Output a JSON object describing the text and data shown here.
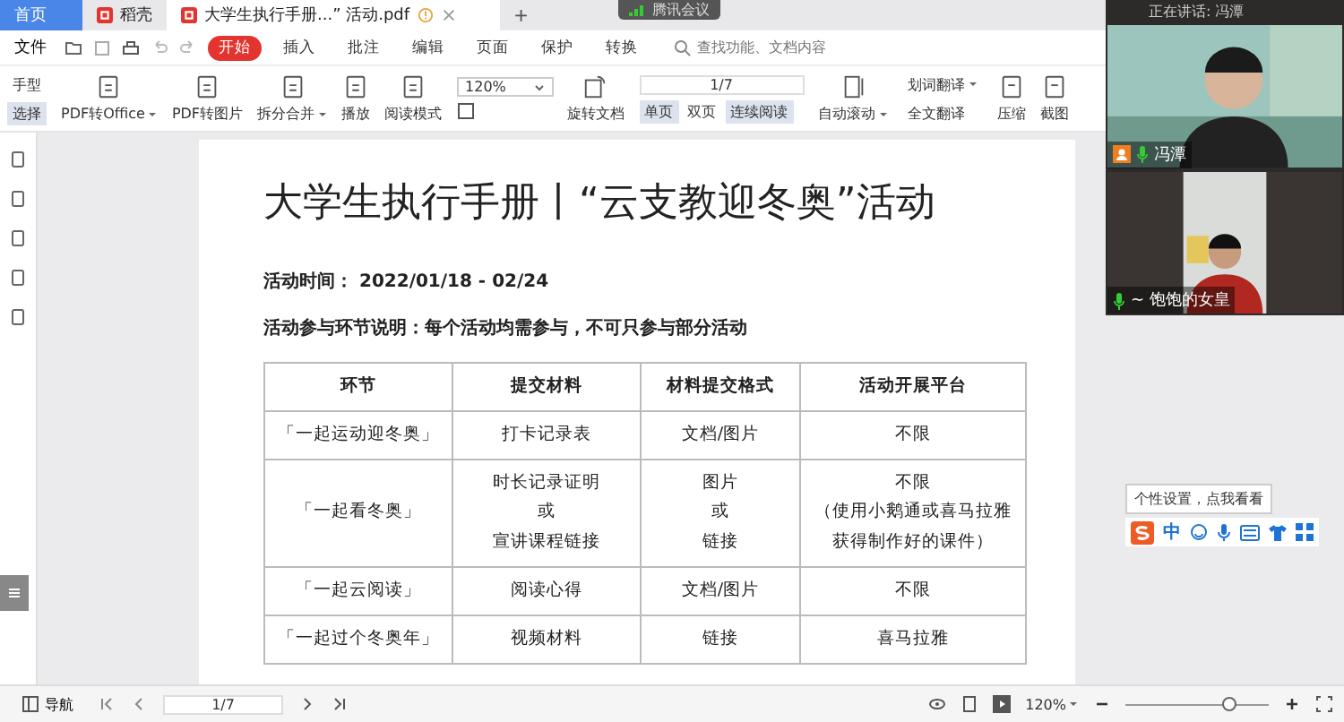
{
  "tabs": [
    {
      "label": "首页",
      "selected": false,
      "kind": "home"
    },
    {
      "label": "稻壳",
      "selected": false,
      "kind": "app"
    },
    {
      "label": "大学生执行手册...” 活动.pdf",
      "selected": true,
      "kind": "document"
    }
  ],
  "new_tab": "+",
  "meeting_badge": "腾讯会议",
  "menu": {
    "file": "文件",
    "tabs": [
      {
        "label": "开始",
        "selected": true
      },
      {
        "label": "插入",
        "selected": false
      },
      {
        "label": "批注",
        "selected": false
      },
      {
        "label": "编辑",
        "selected": false
      },
      {
        "label": "页面",
        "selected": false
      },
      {
        "label": "保护",
        "selected": false
      },
      {
        "label": "转换",
        "selected": false
      }
    ],
    "search": {
      "placeholder": "查找功能、文档内容"
    }
  },
  "toolbar": {
    "modes": [
      {
        "label": "手型",
        "selected": false
      },
      {
        "label": "选择",
        "selected": true
      }
    ],
    "tools": [
      {
        "label": "PDF转Office",
        "dropdown": true
      },
      {
        "label": "PDF转图片",
        "dropdown": false
      },
      {
        "label": "拆分合并",
        "dropdown": true
      },
      {
        "label": "播放",
        "dropdown": false
      },
      {
        "label": "阅读模式",
        "dropdown": false
      }
    ],
    "zoom": "120%",
    "rotate": "旋转文档",
    "page": "1/7",
    "views": [
      {
        "label": "单页",
        "selected": true
      },
      {
        "label": "双页",
        "selected": false
      },
      {
        "label": "连续阅读",
        "selected": true
      }
    ],
    "tools2": [
      {
        "label": "自动滚动",
        "dropdown": true
      },
      {
        "label": "压缩",
        "dropdown": false
      },
      {
        "label": "截图",
        "dropdown": false
      }
    ],
    "translate": [
      {
        "label": "划词翻译",
        "dropdown": true
      },
      {
        "label": "全文翻译",
        "dropdown": false
      }
    ]
  },
  "document": {
    "title": "大学生执行手册丨“云支教迎冬奥”活动",
    "lines": [
      "活动时间： 2022/01/18 - 02/24",
      "活动参与环节说明：每个活动均需参与，不可只参与部分活动"
    ],
    "table": {
      "columns": [
        "环节",
        "提交材料",
        "材料提交格式",
        "活动开展平台"
      ],
      "rows": [
        [
          "「一起运动迎冬奥」",
          "打卡记录表",
          "文档/图片",
          "不限"
        ],
        [
          "「一起看冬奥」",
          [
            "时长记录证明",
            "或",
            "宣讲课程链接"
          ],
          [
            "图片",
            "或",
            "链接"
          ],
          [
            "不限",
            "（使用小鹅通或喜马拉雅",
            "获得制作好的课件）"
          ]
        ],
        [
          "「一起云阅读」",
          "阅读心得",
          "文档/图片",
          "不限"
        ],
        [
          "「一起过个冬奥年」",
          "视频材料",
          "链接",
          "喜马拉雅"
        ]
      ]
    }
  },
  "video": {
    "speaking": "正在讲话: 冯潭",
    "participants": [
      {
        "name": "冯潭",
        "host": true
      },
      {
        "name": "~ 饱饱的女皇",
        "host": false
      }
    ]
  },
  "tooltip": "个性设置，点我看看",
  "ime": {
    "mode": "中"
  },
  "status_bar": {
    "nav": "导航",
    "page": "1/7",
    "zoom": "120%",
    "zoom_slider": {
      "level": 0.72
    }
  }
}
